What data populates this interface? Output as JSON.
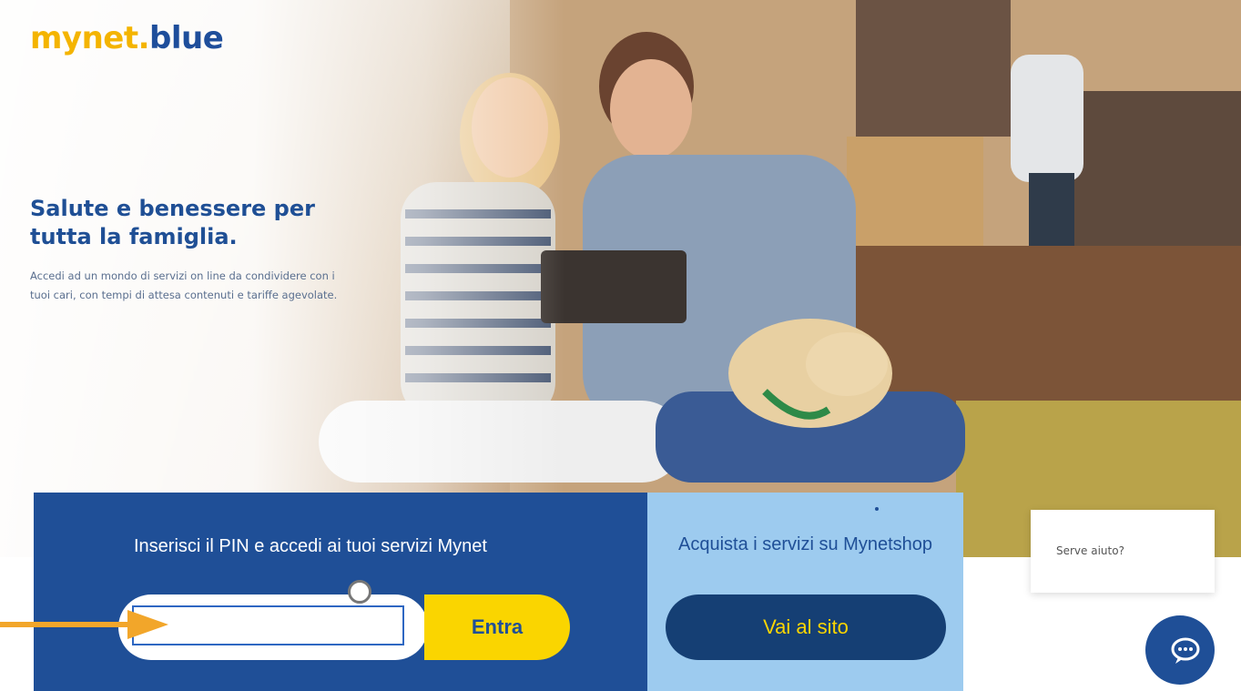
{
  "brand": {
    "logo_part1": "mynet.",
    "logo_part2": "blue",
    "color_yellow": "#f4b400",
    "color_blue": "#1e4e9b"
  },
  "hero": {
    "headline": "Salute e benessere per tutta la famiglia.",
    "subtext": "Accedi ad un mondo di servizi on line da condividere con i tuoi cari, con tempi di attesa contenuti e tariffe agevolate."
  },
  "login": {
    "title": "Inserisci il PIN e accedi ai tuoi servizi Mynet",
    "pin_value": "",
    "submit_label": "Entra"
  },
  "shop": {
    "title": "Acquista i servizi su Mynetshop",
    "button_label": "Vai al sito"
  },
  "help": {
    "text": "Serve aiuto?",
    "chat_icon": "chat-bubble-icon"
  },
  "colors": {
    "login_bg": "#1f4f97",
    "shop_bg": "#9dcbef",
    "accent_yellow": "#fad500",
    "annotation_arrow": "#f2a62a"
  }
}
